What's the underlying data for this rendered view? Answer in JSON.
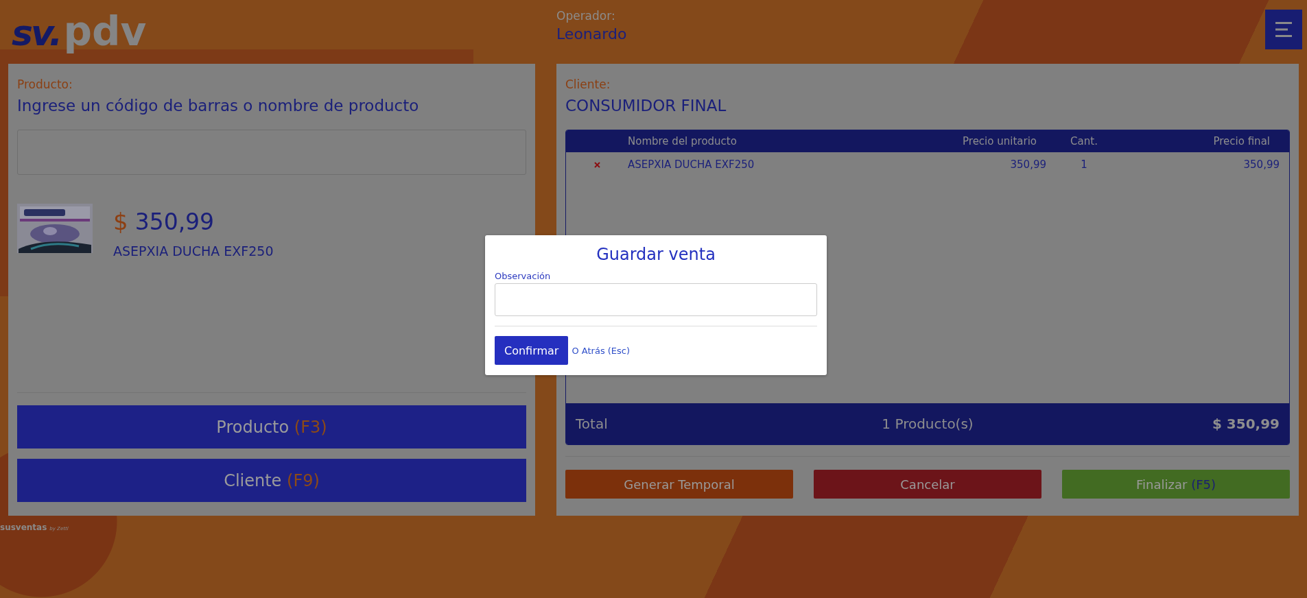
{
  "header": {
    "logo_mark": "sv.",
    "logo_text": "pdv",
    "operator_label": "Operador:",
    "operator_name": "Leonardo"
  },
  "product_panel": {
    "label": "Producto:",
    "heading": "Ingrese un código de barras o nombre de producto",
    "product": {
      "currency": "$",
      "price": "350,99",
      "name": "ASEPXIA DUCHA EXF250"
    },
    "buttons": [
      {
        "label": "Producto",
        "key": "(F3)"
      },
      {
        "label": "Cliente",
        "key": "(F9)"
      }
    ]
  },
  "client_panel": {
    "label": "Cliente:",
    "name": "CONSUMIDOR FINAL",
    "table": {
      "columns": [
        "Nombre del producto",
        "Precio unitario",
        "Cant.",
        "Precio final"
      ],
      "rows": [
        {
          "name": "ASEPXIA DUCHA EXF250",
          "unit_price": "350,99",
          "qty": "1",
          "final_price": "350,99"
        }
      ],
      "footer": {
        "label": "Total",
        "count": "1 Producto(s)",
        "total": "$ 350,99"
      }
    },
    "actions": [
      {
        "label": "Generar Temporal",
        "kind": "warning"
      },
      {
        "label": "Cancelar",
        "kind": "danger"
      },
      {
        "label": "Finalizar",
        "key": "(F5)",
        "kind": "success"
      }
    ]
  },
  "footer_brand": {
    "name": "susventas",
    "by": "by Zettl"
  },
  "modal": {
    "title": "Guardar venta",
    "field_label": "Observación",
    "confirm": "Confirmar",
    "back": "O Atrás (Esc)"
  }
}
